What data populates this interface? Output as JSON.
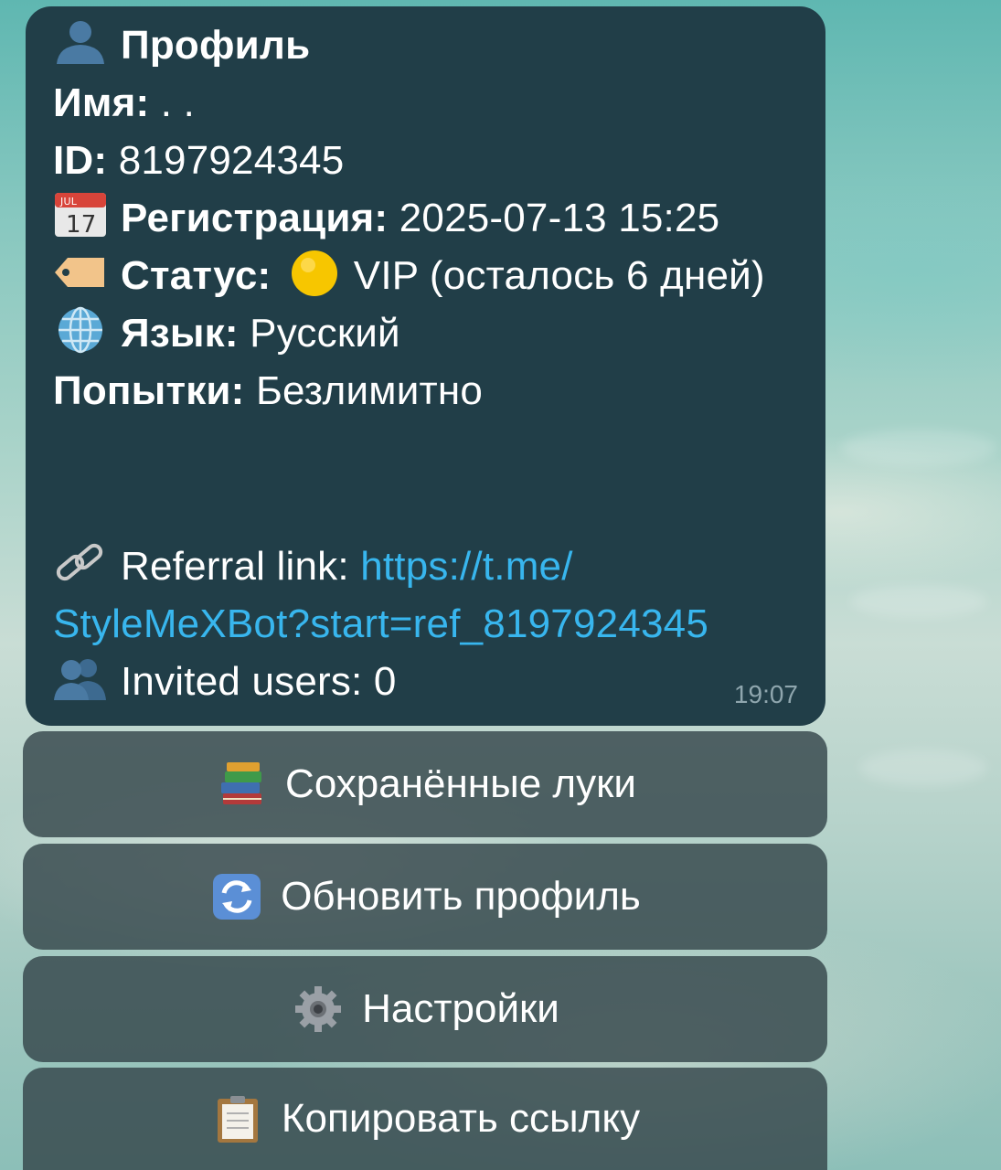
{
  "profile_message": {
    "title": "Профиль",
    "name_label": "Имя:",
    "name_value": " . .",
    "id_label": "ID:",
    "id_value": " 8197924345",
    "registration_label": "Регистрация:",
    "registration_value": " 2025-07-13 15:25",
    "status_label": "Статус:",
    "status_value": "VIP (осталось 6 дней)",
    "language_label": "Язык:",
    "language_value": " Русский",
    "attempts_label": "Попытки:",
    "attempts_value": " Безлимитно",
    "referral_label": "Referral link: ",
    "referral_link_part1": "https://t.me/",
    "referral_link_part2": "StyleMeXBot?start=ref_8197924345",
    "invited_label": "Invited users: 0",
    "time": "19:07",
    "icons": {
      "title": "bust-in-silhouette-icon",
      "registration": "calendar-icon",
      "status": "label-tag-icon",
      "status_dot": "yellow-circle-icon",
      "language": "globe-icon",
      "referral": "link-icon",
      "invited": "busts-in-silhouette-icon"
    },
    "colors": {
      "bubble": "#213e48",
      "link": "#38b6ee",
      "time": "#8fa6ae",
      "status_dot": "#f7c600"
    }
  },
  "keyboard": {
    "buttons": [
      {
        "label": "Сохранённые луки",
        "icon": "books-icon"
      },
      {
        "label": "Обновить профиль",
        "icon": "refresh-icon"
      },
      {
        "label": "Настройки",
        "icon": "gear-icon"
      },
      {
        "label": "Копировать ссылку",
        "icon": "clipboard-icon"
      }
    ],
    "colors": {
      "button_bg": "rgba(52, 70, 74, 0.82)"
    }
  }
}
